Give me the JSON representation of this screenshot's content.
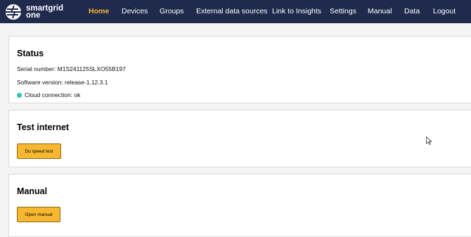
{
  "brand": {
    "line1": "smartgrid",
    "line2": "one"
  },
  "nav": [
    {
      "label": "Home",
      "active": true
    },
    {
      "label": "Devices"
    },
    {
      "label": "Groups"
    },
    {
      "label": "External data sources"
    },
    {
      "label": "Link to Insights"
    },
    {
      "label": "Settings"
    },
    {
      "label": "Manual"
    },
    {
      "label": "Data"
    },
    {
      "label": "Logout"
    }
  ],
  "status": {
    "title": "Status",
    "serial": "Serial number: M1S241125SLXO55B197",
    "software": "Software version: release-1.12.3.1",
    "cloud": "Cloud connection: ok",
    "cloud_color": "#2ec4b6"
  },
  "test_internet": {
    "title": "Test internet",
    "button": "Do speed test"
  },
  "manual": {
    "title": "Manual",
    "button": "Open manual"
  },
  "colors": {
    "topbar": "#1f2a4d",
    "accent": "#f7b731",
    "background": "#f4f4f4"
  }
}
